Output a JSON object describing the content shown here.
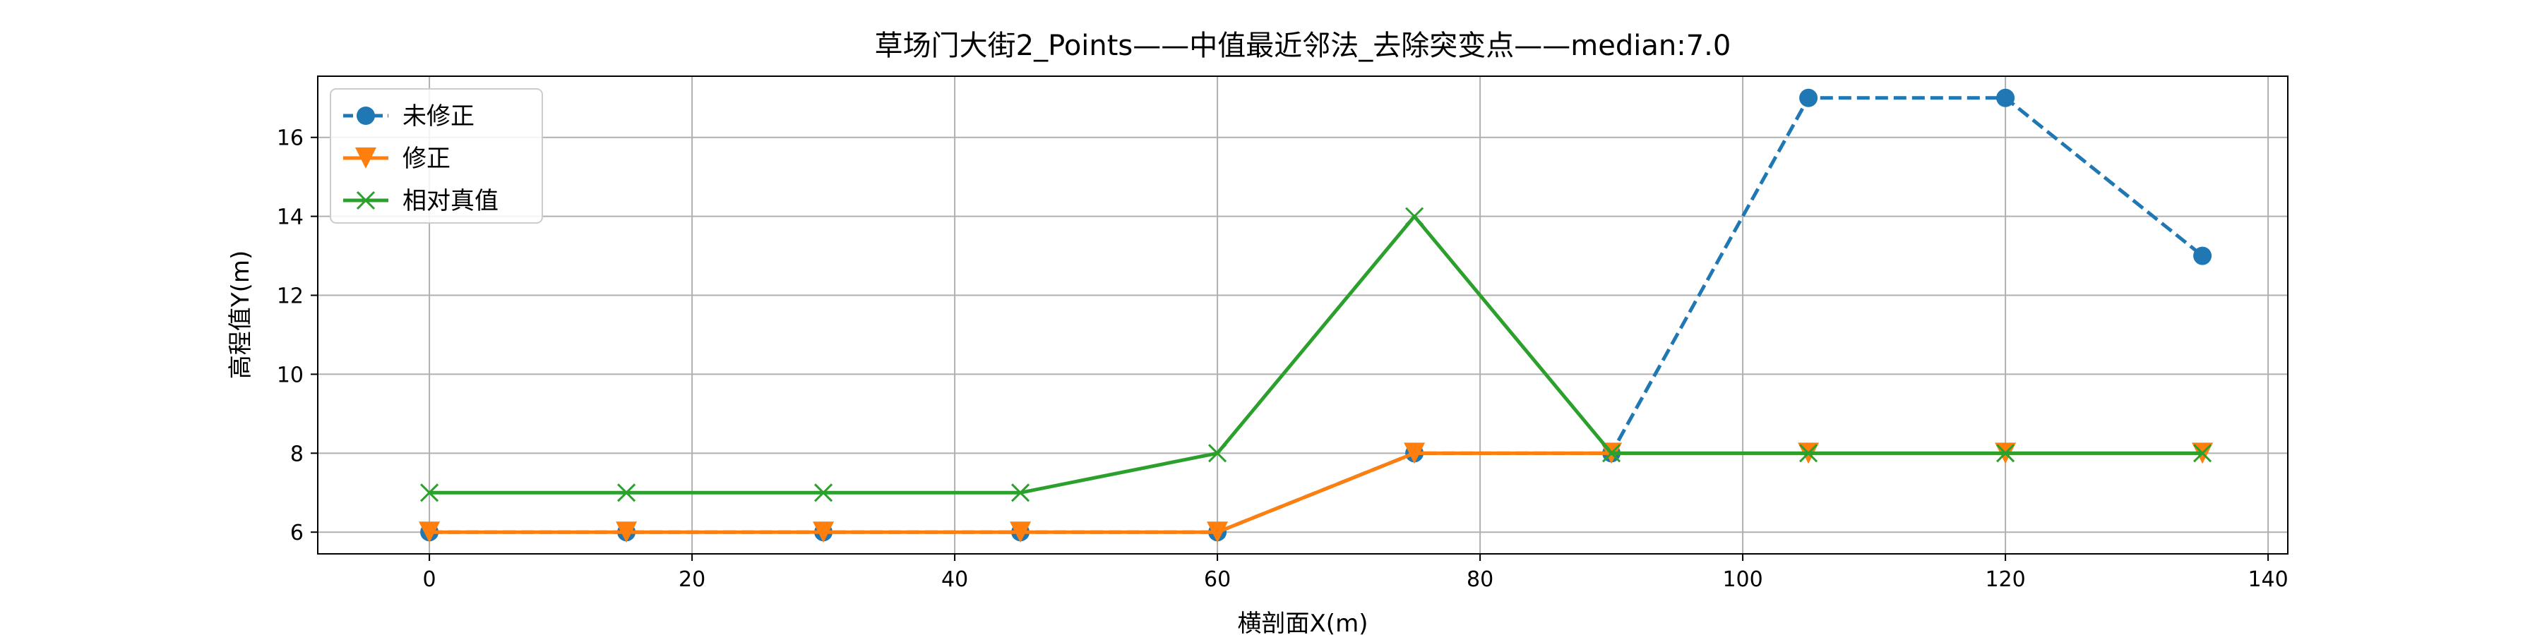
{
  "chart_data": {
    "type": "line",
    "title": "草场门大街2_Points——中值最近邻法_去除突变点——median:7.0",
    "xlabel": "横剖面X(m)",
    "ylabel": "高程值Y(m)",
    "xlim": [
      -8.5,
      141.5
    ],
    "ylim": [
      5.45,
      17.55
    ],
    "xticks": [
      0,
      20,
      40,
      60,
      80,
      100,
      120,
      140
    ],
    "yticks": [
      6,
      8,
      10,
      12,
      14,
      16
    ],
    "grid": true,
    "legend_position": "upper-left",
    "x": [
      0,
      15,
      30,
      45,
      60,
      75,
      90,
      105,
      120,
      135
    ],
    "series": [
      {
        "name": "未修正",
        "values": [
          6,
          6,
          6,
          6,
          6,
          8,
          8,
          17,
          17,
          13
        ],
        "color": "#1f77b4",
        "marker": "circle",
        "linestyle": "dashed"
      },
      {
        "name": "修正",
        "values": [
          6,
          6,
          6,
          6,
          6,
          8,
          8,
          8,
          8,
          8
        ],
        "color": "#ff7f0e",
        "marker": "triangle-down",
        "linestyle": "solid"
      },
      {
        "name": "相对真值",
        "values": [
          7,
          7,
          7,
          7,
          8,
          14,
          8,
          8,
          8,
          8
        ],
        "color": "#2ca02c",
        "marker": "x",
        "linestyle": "solid"
      }
    ]
  }
}
